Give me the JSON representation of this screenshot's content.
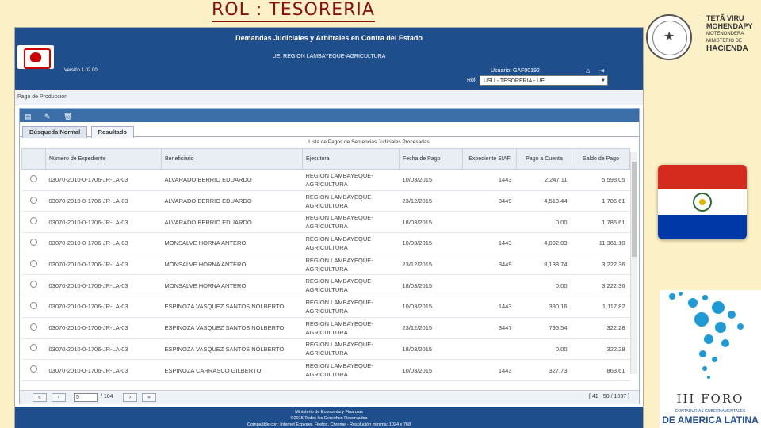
{
  "slide": {
    "title": "ROL :  TESORERIA"
  },
  "logos": {
    "ministry_line1": "TETÃ VIRU",
    "ministry_line2": "MOHENDAPY",
    "ministry_line3": "MOTENONDERA",
    "ministry_line4": "MINISTERIO DE",
    "ministry_line5": "HACIENDA",
    "foro_title": "III FORO",
    "foro_sub": "CONTADURÍAS GUBERNAMENTALES",
    "foro_sub2": "DE AMERICA LATINA"
  },
  "app": {
    "header_title": "Demandas Judiciales y Arbitrales en Contra del Estado",
    "ue": "UE: REGION LAMBAYEQUE-AGRICULTURA",
    "version": "Versión 1.02.00",
    "user": "Usuario: GAF00192",
    "rol_label": "Rol:",
    "rol_value": "USU - TESORERIA - UE",
    "section": "Pago de Producción",
    "tabs": [
      "Búsqueda Normal",
      "Resultado"
    ],
    "list_title": "Lista de Pagos de Sentencias Judiciales Procesadas",
    "columns": [
      "Número de Expediente",
      "Beneficiario",
      "Ejecutora",
      "Fecha de Pago",
      "Expediente SIAF",
      "Pago a Cuenta",
      "Saldo de Pago"
    ],
    "rows": [
      [
        "03070-2010-0-1706-JR-LA-03",
        "ALVARADO BERRIO EDUARDO",
        "REGION LAMBAYEQUE-AGRICULTURA",
        "10/03/2015",
        "1443",
        "2,247.11",
        "5,598.05"
      ],
      [
        "03070-2010-0-1706-JR-LA-03",
        "ALVARADO BERRIO EDUARDO",
        "REGION LAMBAYEQUE-AGRICULTURA",
        "23/12/2015",
        "3449",
        "4,513.44",
        "1,786.61"
      ],
      [
        "03070-2010-0-1706-JR-LA-03",
        "ALVARADO BERRIO EDUARDO",
        "REGION LAMBAYEQUE-AGRICULTURA",
        "18/03/2015",
        "",
        "0.00",
        "1,786.61"
      ],
      [
        "03070-2010-0-1706-JR-LA-03",
        "MONSALVE HORNA ANTERO",
        "REGION LAMBAYEQUE-AGRICULTURA",
        "10/03/2015",
        "1443",
        "4,092.03",
        "11,361.10"
      ],
      [
        "03070-2010-0-1706-JR-LA-03",
        "MONSALVE HORNA ANTERO",
        "REGION LAMBAYEQUE-AGRICULTURA",
        "23/12/2015",
        "3449",
        "8,138.74",
        "3,222.36"
      ],
      [
        "03070-2010-0-1706-JR-LA-03",
        "MONSALVE HORNA ANTERO",
        "REGION LAMBAYEQUE-AGRICULTURA",
        "18/03/2015",
        "",
        "0.00",
        "3,222.36"
      ],
      [
        "03070-2010-0-1706-JR-LA-03",
        "ESPINOZA VASQUEZ SANTOS NOLBERTO",
        "REGION LAMBAYEQUE-AGRICULTURA",
        "10/03/2015",
        "1443",
        "390.16",
        "1,117.82"
      ],
      [
        "03070-2010-0-1706-JR-LA-03",
        "ESPINOZA VASQUEZ SANTOS NOLBERTO",
        "REGION LAMBAYEQUE-AGRICULTURA",
        "23/12/2015",
        "3447",
        "795.54",
        "322.28"
      ],
      [
        "03070-2010-0-1706-JR-LA-03",
        "ESPINOZA VASQUEZ SANTOS NOLBERTO",
        "REGION LAMBAYEQUE-AGRICULTURA",
        "18/03/2015",
        "",
        "0.00",
        "322.28"
      ],
      [
        "03070-2010-0-1706-JR-LA-03",
        "ESPINOZA CARRASCO GILBERTO",
        "REGION LAMBAYEQUE-AGRICULTURA",
        "10/03/2015",
        "1443",
        "327.73",
        "863.61"
      ]
    ],
    "pager": {
      "page": "5",
      "total": "/ 104",
      "info": "[ 41 - 50 / 1037 ]"
    },
    "footer_line1": "Ministerio de Economía y Finanzas",
    "footer_line2": "©2015 Todos los Derechos Reservados",
    "footer_line3": "Compatible con: Internet Explorer, Firefox, Chrome - Resolución mínima: 1024 x 768"
  }
}
